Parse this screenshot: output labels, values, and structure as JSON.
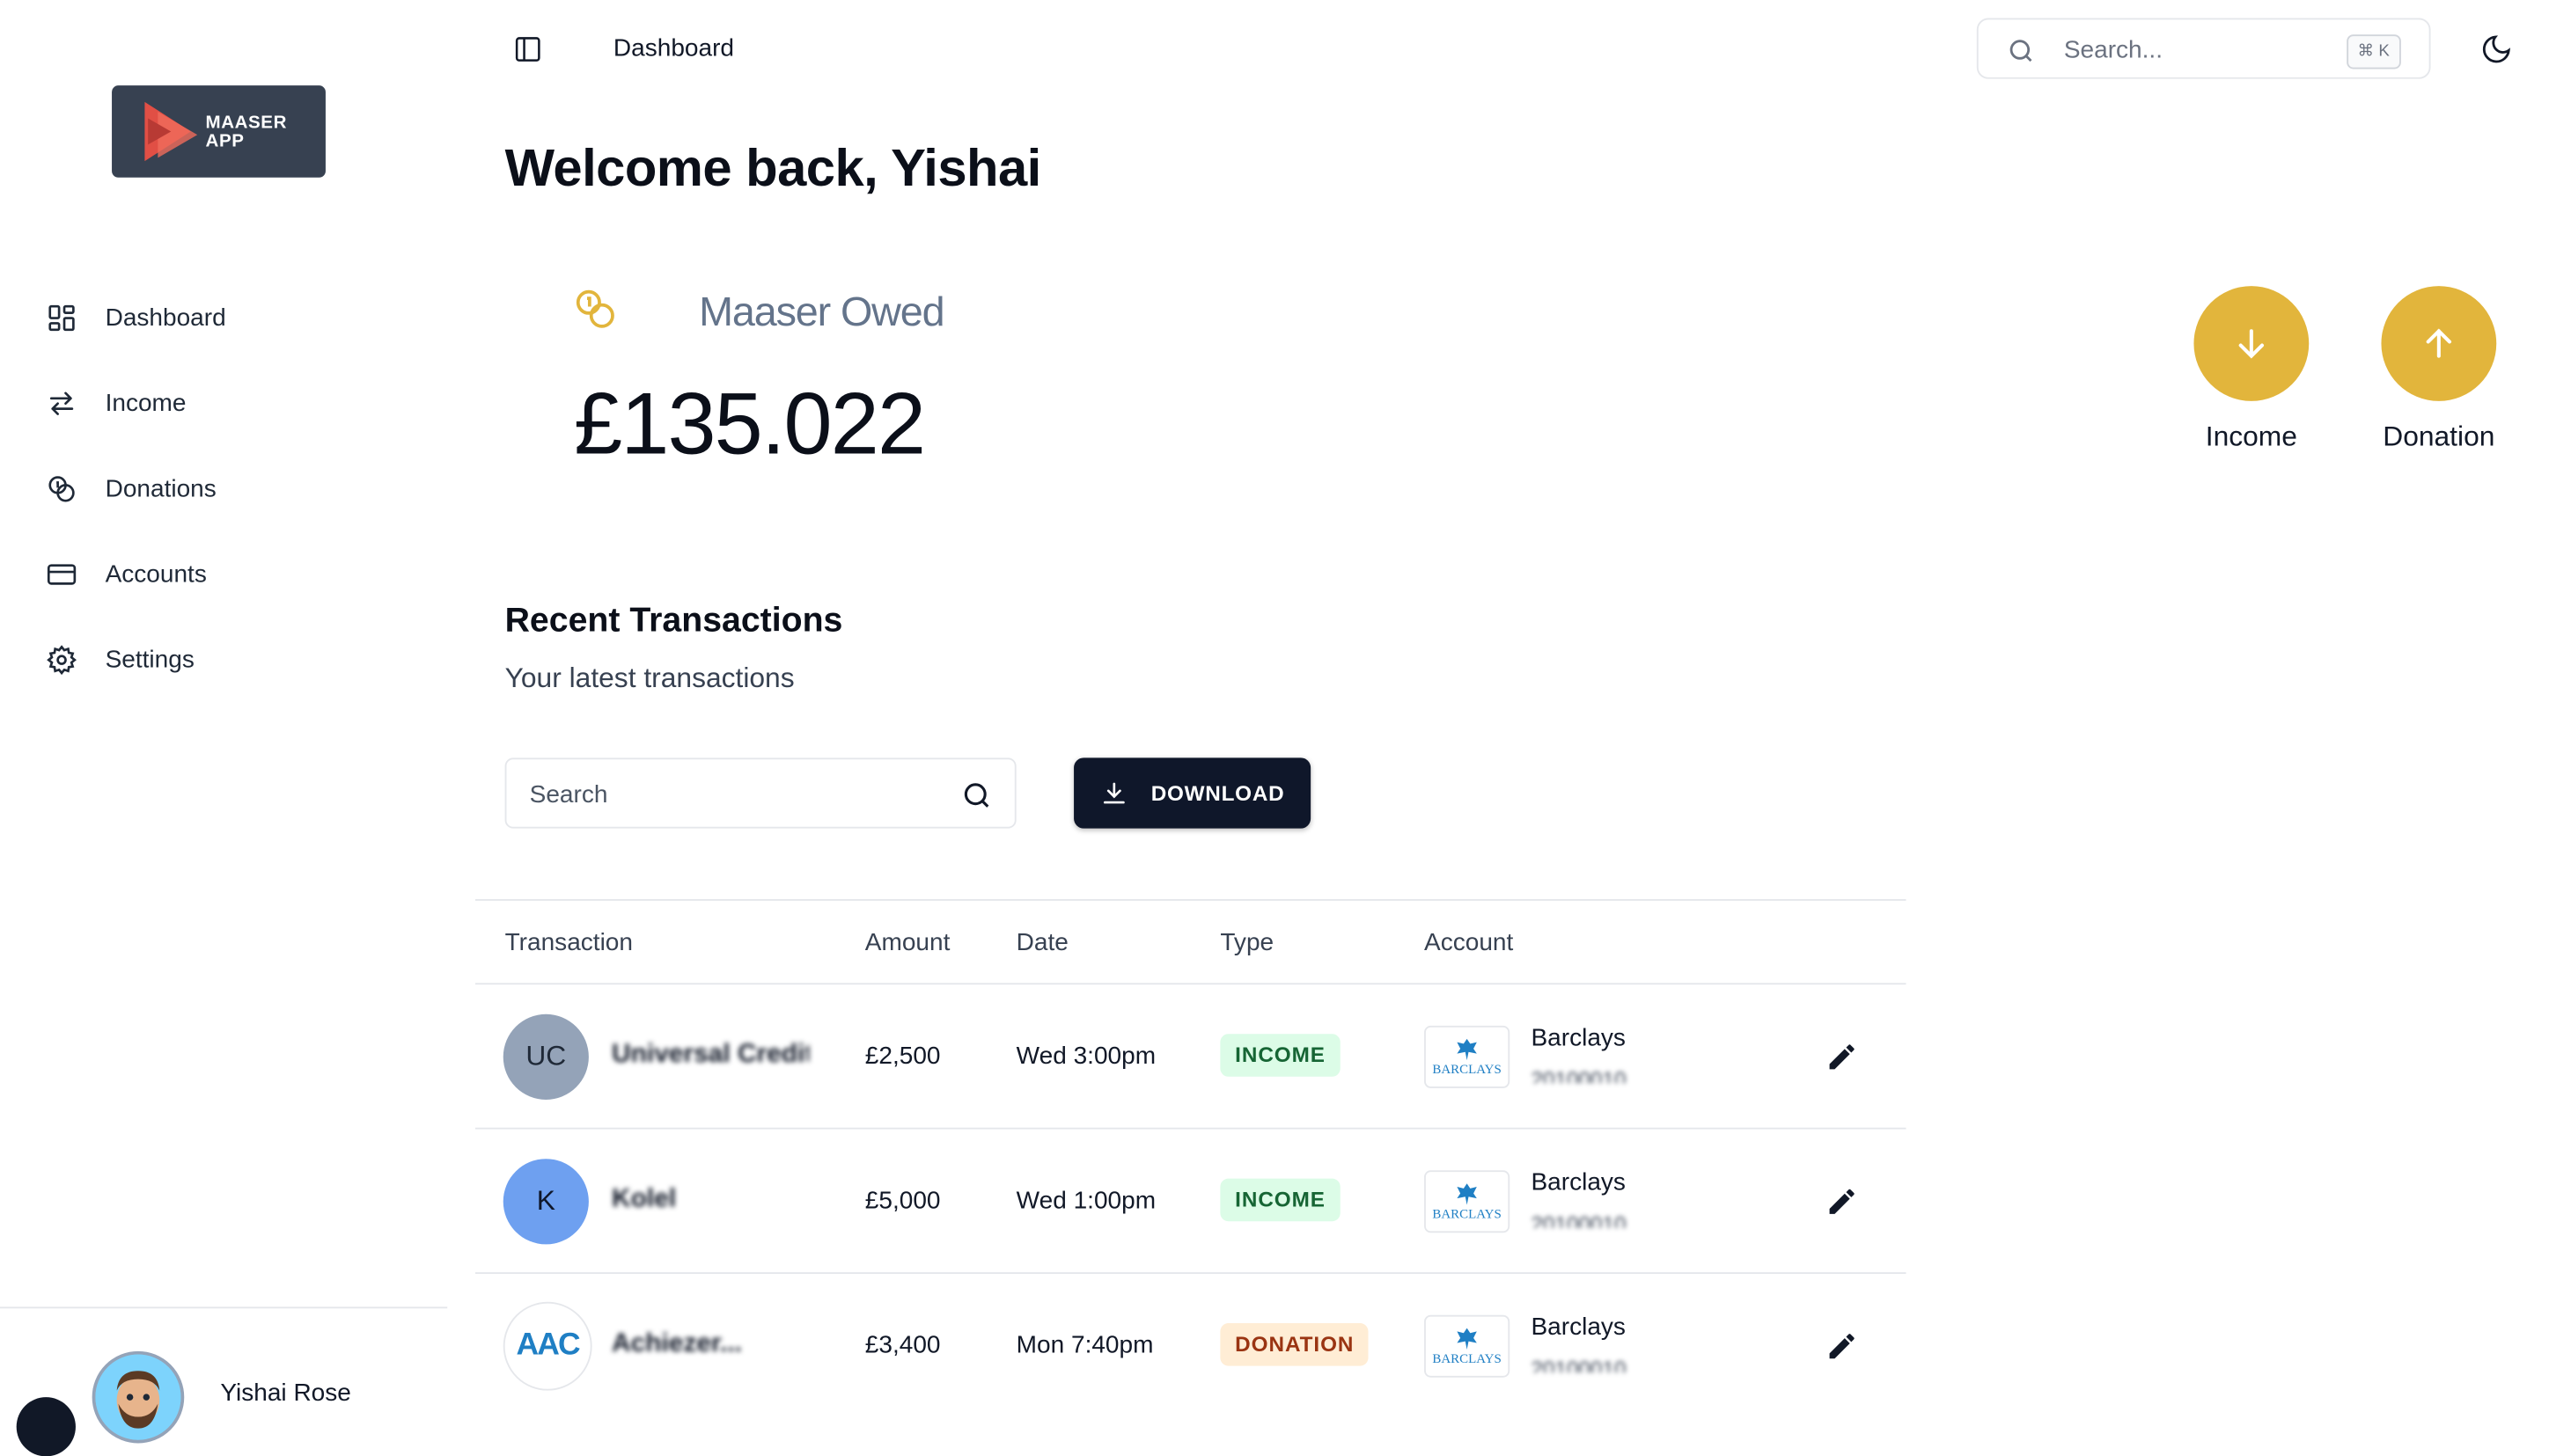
{
  "app": {
    "logo_line1": "MAASER",
    "logo_line2": "APP"
  },
  "sidebar": {
    "items": [
      {
        "label": "Dashboard",
        "icon": "dashboard-grid-icon"
      },
      {
        "label": "Income",
        "icon": "swap-arrows-icon"
      },
      {
        "label": "Donations",
        "icon": "coins-icon"
      },
      {
        "label": "Accounts",
        "icon": "credit-card-icon"
      },
      {
        "label": "Settings",
        "icon": "gear-icon"
      }
    ],
    "user": {
      "name": "Yishai Rose"
    }
  },
  "topbar": {
    "breadcrumb": "Dashboard",
    "search_placeholder": "Search...",
    "shortcut": "⌘ K"
  },
  "main": {
    "welcome": "Welcome back, Yishai",
    "owed_label": "Maaser Owed",
    "owed_value": "£135.022",
    "actions": [
      {
        "label": "Income",
        "icon": "arrow-down-icon"
      },
      {
        "label": "Donation",
        "icon": "arrow-up-icon"
      }
    ],
    "transactions": {
      "title": "Recent Transactions",
      "subtitle": "Your latest transactions",
      "search_placeholder": "Search",
      "download_label": "DOWNLOAD",
      "columns": [
        "Transaction",
        "Amount",
        "Date",
        "Type",
        "Account"
      ],
      "rows": [
        {
          "initials": "UC",
          "avatar_color": "#94a3b8",
          "name": "Universal Credit",
          "amount": "£2,500",
          "date": "Wed 3:00pm",
          "type": "INCOME",
          "bank": "Barclays",
          "account": "20100010"
        },
        {
          "initials": "K",
          "avatar_color": "#6ea0f0",
          "name": "Kolel",
          "amount": "£5,000",
          "date": "Wed 1:00pm",
          "type": "INCOME",
          "bank": "Barclays",
          "account": "20100010"
        },
        {
          "initials": "AAC",
          "avatar_color": "#ffffff",
          "name": "Achiezer...",
          "amount": "£3,400",
          "date": "Mon 7:40pm",
          "type": "DONATION",
          "bank": "Barclays",
          "account": "20100010"
        }
      ],
      "bank_logo_text": "BARCLAYS"
    }
  },
  "colors": {
    "accent": "#e2b53c",
    "primary": "#0f172a",
    "income_badge": "#dcfce7",
    "donation_badge": "#ffedd5"
  }
}
